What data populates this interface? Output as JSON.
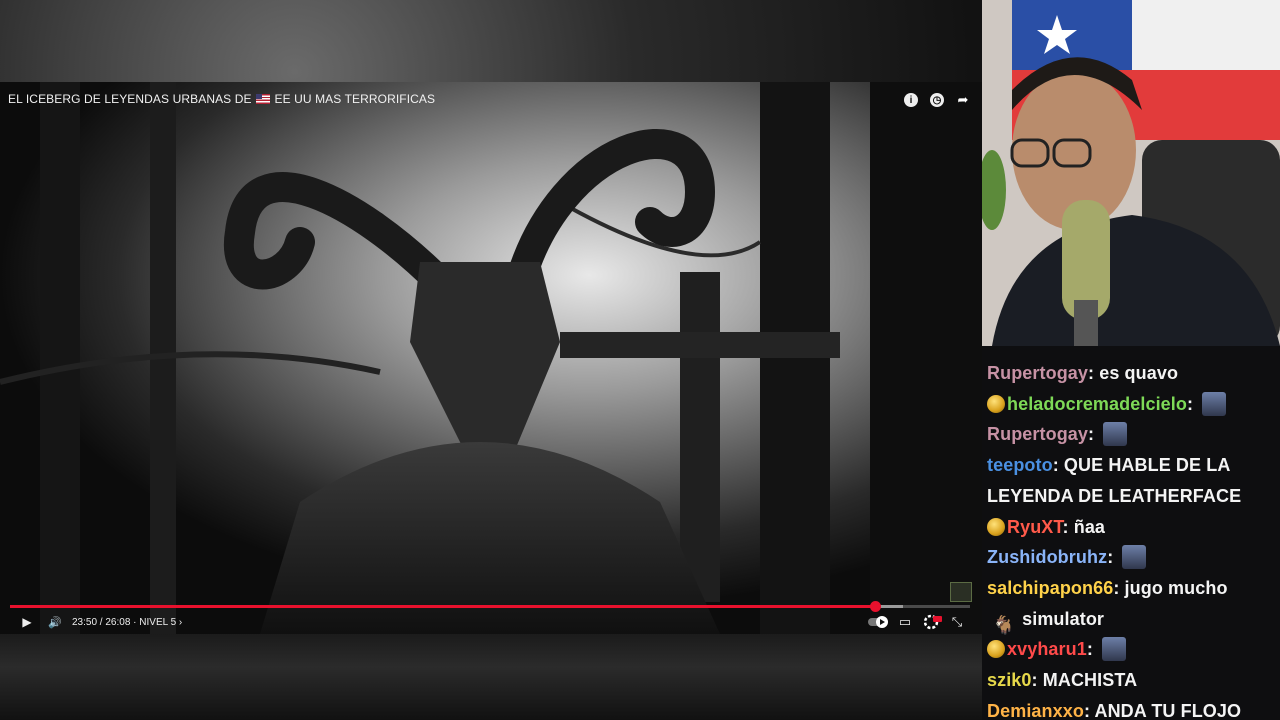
{
  "player": {
    "title_prefix": "EL ICEBERG DE LEYENDAS URBANAS DE",
    "title_suffix": "EE UU MAS TERRORIFICAS",
    "icons": {
      "info": "info-icon",
      "watch_later": "clock-icon",
      "share": "share-arrow-icon"
    },
    "progress_fraction": 0.9014,
    "buffered_fraction": 0.93,
    "time_display": "23:50 / 26:08 · NIVEL 5 ›",
    "controls": {
      "play": "▶",
      "volume": "🔊",
      "autoplay": "autoplay-toggle",
      "subtitles": "▭",
      "miniplayer": "⊡",
      "exit_fullscreen": "⤡"
    }
  },
  "chat": {
    "messages": [
      {
        "user": "Rupertogay",
        "color": "#c792a5",
        "text": "es quavo",
        "badge": false,
        "emote": false
      },
      {
        "user": "heladocremadelcielo",
        "color": "#7ed957",
        "text": "",
        "badge": true,
        "emote": true
      },
      {
        "user": "Rupertogay",
        "color": "#c792a5",
        "text": "",
        "badge": false,
        "emote": true
      },
      {
        "user": "teepoto",
        "color": "#4a90e2",
        "text": "QUE HABLE DE LA",
        "badge": false,
        "emote": false
      },
      {
        "user": "",
        "color": "#ffffff",
        "text": "LEYENDA DE LEATHERFACE",
        "badge": false,
        "emote": false
      },
      {
        "user": "RyuXT",
        "color": "#ff5a4a",
        "text": "ñaa",
        "badge": true,
        "emote": false
      },
      {
        "user": "Zushidobruhz",
        "color": "#8ab4f8",
        "text": "",
        "badge": false,
        "emote": true
      },
      {
        "user": "salchipapon66",
        "color": "#ffd24a",
        "text": "jugo mucho",
        "badge": false,
        "emote": false
      },
      {
        "user": "",
        "color": "#ffffff",
        "text": "simulator",
        "badge": false,
        "emote": false,
        "goat": true
      },
      {
        "user": "xvyharu1",
        "color": "#ff4a4a",
        "text": "",
        "badge": true,
        "emote": true
      },
      {
        "user": "szik0",
        "color": "#e6d84a",
        "text": "MACHISTA",
        "badge": false,
        "emote": false
      },
      {
        "user": "Demianxxo",
        "color": "#ffb347",
        "text": "ANDA TU FLOJO",
        "badge": false,
        "emote": false
      }
    ]
  }
}
